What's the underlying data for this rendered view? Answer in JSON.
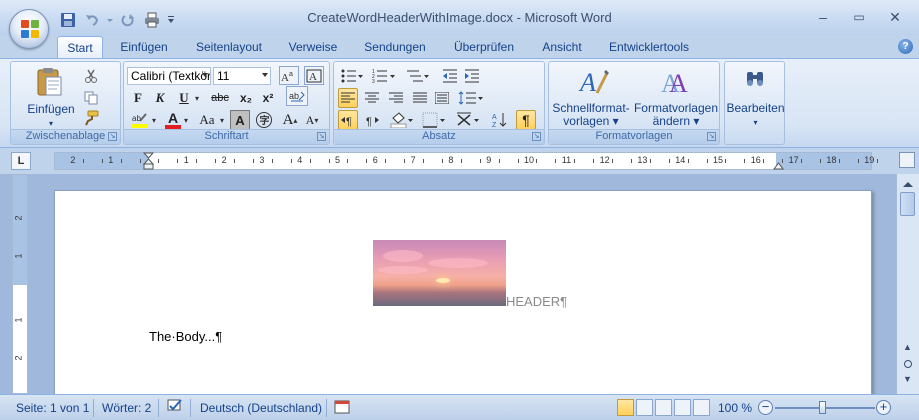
{
  "window": {
    "title": "CreateWordHeaderWithImage.docx - Microsoft Word",
    "minimize": "–",
    "maximize": "▭",
    "close": "✕"
  },
  "tabs": [
    {
      "label": "Start",
      "active": true
    },
    {
      "label": "Einfügen"
    },
    {
      "label": "Seitenlayout"
    },
    {
      "label": "Verweise"
    },
    {
      "label": "Sendungen"
    },
    {
      "label": "Überprüfen"
    },
    {
      "label": "Ansicht"
    },
    {
      "label": "Entwicklertools"
    }
  ],
  "help": "?",
  "ribbon": {
    "clipboard": {
      "label": "Zwischenablage",
      "paste_label": "Einfügen"
    },
    "font": {
      "label": "Schriftart",
      "font_name": "Calibri (Textkörper)",
      "font_size": "11",
      "bold": "F",
      "italic": "K",
      "underline": "U",
      "strike": "abc",
      "subscript": "x₂",
      "superscript": "x²",
      "change_case": "Aa",
      "font_color": "A",
      "grow": "A",
      "shrink": "A"
    },
    "paragraph": {
      "label": "Absatz",
      "pilcrow": "¶"
    },
    "styles": {
      "label": "Formatvorlagen",
      "quick_styles_line1": "Schnellformat-",
      "quick_styles_line2": "vorlagen ▾",
      "change_styles_line1": "Formatvorlagen",
      "change_styles_line2": "ändern ▾"
    },
    "editing": {
      "label": "Bearbeiten"
    }
  },
  "ruler": {
    "tab_selector": "L",
    "numbers": [
      "2",
      "1",
      "1",
      "2",
      "3",
      "4",
      "5",
      "6",
      "7",
      "8",
      "9",
      "10",
      "11",
      "12",
      "13",
      "14",
      "15",
      "16",
      "17",
      "18",
      "19"
    ]
  },
  "document": {
    "header_text": "HEADER¶",
    "body_text": "The·Body...¶"
  },
  "status": {
    "page": "Seite: 1 von 1",
    "words": "Wörter: 2",
    "language": "Deutsch (Deutschland)",
    "zoom": "100 %",
    "zoom_out": "−",
    "zoom_in": "+"
  }
}
